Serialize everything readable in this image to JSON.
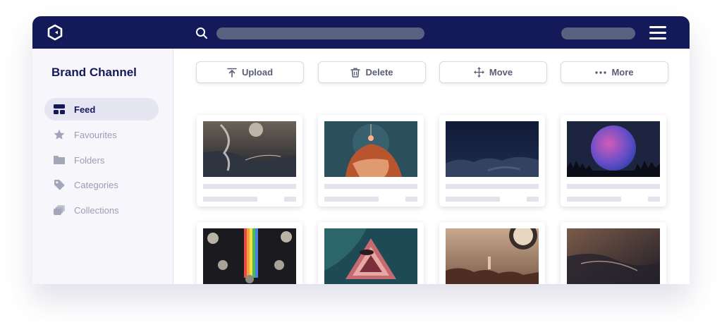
{
  "app": {
    "name": "Brand Channel"
  },
  "sidebar": {
    "items": [
      {
        "label": "Feed",
        "icon": "feed-icon",
        "active": true
      },
      {
        "label": "Favourites",
        "icon": "star-icon",
        "active": false
      },
      {
        "label": "Folders",
        "icon": "folder-icon",
        "active": false
      },
      {
        "label": "Categories",
        "icon": "tag-icon",
        "active": false
      },
      {
        "label": "Collections",
        "icon": "collections-icon",
        "active": false
      }
    ]
  },
  "toolbar": {
    "upload_label": "Upload",
    "delete_label": "Delete",
    "move_label": "Move",
    "more_label": "More"
  },
  "gallery": {
    "items": [
      {
        "subject": "moon-over-clouds-art"
      },
      {
        "subject": "figure-head-with-glowing-orb-art"
      },
      {
        "subject": "night-sky-clouds"
      },
      {
        "subject": "pink-blue-moon-over-forest"
      },
      {
        "subject": "moon-phases-with-rainbow"
      },
      {
        "subject": "geometric-triangle-galaxy"
      },
      {
        "subject": "surreal-sun-over-rocks"
      },
      {
        "subject": "starry-beach-shoreline"
      }
    ]
  },
  "colors": {
    "topbar": "#14195a",
    "accent": "#14195a",
    "muted_text": "#9a9cb3",
    "placeholder_bar": "#e2e3ec"
  }
}
